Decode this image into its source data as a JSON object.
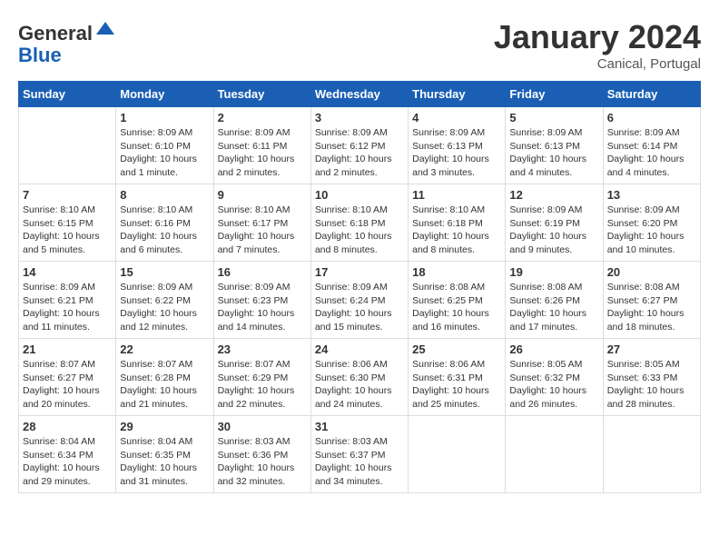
{
  "logo": {
    "general": "General",
    "blue": "Blue"
  },
  "header": {
    "month": "January 2024",
    "location": "Canical, Portugal"
  },
  "weekdays": [
    "Sunday",
    "Monday",
    "Tuesday",
    "Wednesday",
    "Thursday",
    "Friday",
    "Saturday"
  ],
  "weeks": [
    [
      {
        "day": "",
        "sunrise": "",
        "sunset": "",
        "daylight": ""
      },
      {
        "day": "1",
        "sunrise": "Sunrise: 8:09 AM",
        "sunset": "Sunset: 6:10 PM",
        "daylight": "Daylight: 10 hours and 1 minute."
      },
      {
        "day": "2",
        "sunrise": "Sunrise: 8:09 AM",
        "sunset": "Sunset: 6:11 PM",
        "daylight": "Daylight: 10 hours and 2 minutes."
      },
      {
        "day": "3",
        "sunrise": "Sunrise: 8:09 AM",
        "sunset": "Sunset: 6:12 PM",
        "daylight": "Daylight: 10 hours and 2 minutes."
      },
      {
        "day": "4",
        "sunrise": "Sunrise: 8:09 AM",
        "sunset": "Sunset: 6:13 PM",
        "daylight": "Daylight: 10 hours and 3 minutes."
      },
      {
        "day": "5",
        "sunrise": "Sunrise: 8:09 AM",
        "sunset": "Sunset: 6:13 PM",
        "daylight": "Daylight: 10 hours and 4 minutes."
      },
      {
        "day": "6",
        "sunrise": "Sunrise: 8:09 AM",
        "sunset": "Sunset: 6:14 PM",
        "daylight": "Daylight: 10 hours and 4 minutes."
      }
    ],
    [
      {
        "day": "7",
        "sunrise": "Sunrise: 8:10 AM",
        "sunset": "Sunset: 6:15 PM",
        "daylight": "Daylight: 10 hours and 5 minutes."
      },
      {
        "day": "8",
        "sunrise": "Sunrise: 8:10 AM",
        "sunset": "Sunset: 6:16 PM",
        "daylight": "Daylight: 10 hours and 6 minutes."
      },
      {
        "day": "9",
        "sunrise": "Sunrise: 8:10 AM",
        "sunset": "Sunset: 6:17 PM",
        "daylight": "Daylight: 10 hours and 7 minutes."
      },
      {
        "day": "10",
        "sunrise": "Sunrise: 8:10 AM",
        "sunset": "Sunset: 6:18 PM",
        "daylight": "Daylight: 10 hours and 8 minutes."
      },
      {
        "day": "11",
        "sunrise": "Sunrise: 8:10 AM",
        "sunset": "Sunset: 6:18 PM",
        "daylight": "Daylight: 10 hours and 8 minutes."
      },
      {
        "day": "12",
        "sunrise": "Sunrise: 8:09 AM",
        "sunset": "Sunset: 6:19 PM",
        "daylight": "Daylight: 10 hours and 9 minutes."
      },
      {
        "day": "13",
        "sunrise": "Sunrise: 8:09 AM",
        "sunset": "Sunset: 6:20 PM",
        "daylight": "Daylight: 10 hours and 10 minutes."
      }
    ],
    [
      {
        "day": "14",
        "sunrise": "Sunrise: 8:09 AM",
        "sunset": "Sunset: 6:21 PM",
        "daylight": "Daylight: 10 hours and 11 minutes."
      },
      {
        "day": "15",
        "sunrise": "Sunrise: 8:09 AM",
        "sunset": "Sunset: 6:22 PM",
        "daylight": "Daylight: 10 hours and 12 minutes."
      },
      {
        "day": "16",
        "sunrise": "Sunrise: 8:09 AM",
        "sunset": "Sunset: 6:23 PM",
        "daylight": "Daylight: 10 hours and 14 minutes."
      },
      {
        "day": "17",
        "sunrise": "Sunrise: 8:09 AM",
        "sunset": "Sunset: 6:24 PM",
        "daylight": "Daylight: 10 hours and 15 minutes."
      },
      {
        "day": "18",
        "sunrise": "Sunrise: 8:08 AM",
        "sunset": "Sunset: 6:25 PM",
        "daylight": "Daylight: 10 hours and 16 minutes."
      },
      {
        "day": "19",
        "sunrise": "Sunrise: 8:08 AM",
        "sunset": "Sunset: 6:26 PM",
        "daylight": "Daylight: 10 hours and 17 minutes."
      },
      {
        "day": "20",
        "sunrise": "Sunrise: 8:08 AM",
        "sunset": "Sunset: 6:27 PM",
        "daylight": "Daylight: 10 hours and 18 minutes."
      }
    ],
    [
      {
        "day": "21",
        "sunrise": "Sunrise: 8:07 AM",
        "sunset": "Sunset: 6:27 PM",
        "daylight": "Daylight: 10 hours and 20 minutes."
      },
      {
        "day": "22",
        "sunrise": "Sunrise: 8:07 AM",
        "sunset": "Sunset: 6:28 PM",
        "daylight": "Daylight: 10 hours and 21 minutes."
      },
      {
        "day": "23",
        "sunrise": "Sunrise: 8:07 AM",
        "sunset": "Sunset: 6:29 PM",
        "daylight": "Daylight: 10 hours and 22 minutes."
      },
      {
        "day": "24",
        "sunrise": "Sunrise: 8:06 AM",
        "sunset": "Sunset: 6:30 PM",
        "daylight": "Daylight: 10 hours and 24 minutes."
      },
      {
        "day": "25",
        "sunrise": "Sunrise: 8:06 AM",
        "sunset": "Sunset: 6:31 PM",
        "daylight": "Daylight: 10 hours and 25 minutes."
      },
      {
        "day": "26",
        "sunrise": "Sunrise: 8:05 AM",
        "sunset": "Sunset: 6:32 PM",
        "daylight": "Daylight: 10 hours and 26 minutes."
      },
      {
        "day": "27",
        "sunrise": "Sunrise: 8:05 AM",
        "sunset": "Sunset: 6:33 PM",
        "daylight": "Daylight: 10 hours and 28 minutes."
      }
    ],
    [
      {
        "day": "28",
        "sunrise": "Sunrise: 8:04 AM",
        "sunset": "Sunset: 6:34 PM",
        "daylight": "Daylight: 10 hours and 29 minutes."
      },
      {
        "day": "29",
        "sunrise": "Sunrise: 8:04 AM",
        "sunset": "Sunset: 6:35 PM",
        "daylight": "Daylight: 10 hours and 31 minutes."
      },
      {
        "day": "30",
        "sunrise": "Sunrise: 8:03 AM",
        "sunset": "Sunset: 6:36 PM",
        "daylight": "Daylight: 10 hours and 32 minutes."
      },
      {
        "day": "31",
        "sunrise": "Sunrise: 8:03 AM",
        "sunset": "Sunset: 6:37 PM",
        "daylight": "Daylight: 10 hours and 34 minutes."
      },
      {
        "day": "",
        "sunrise": "",
        "sunset": "",
        "daylight": ""
      },
      {
        "day": "",
        "sunrise": "",
        "sunset": "",
        "daylight": ""
      },
      {
        "day": "",
        "sunrise": "",
        "sunset": "",
        "daylight": ""
      }
    ]
  ]
}
